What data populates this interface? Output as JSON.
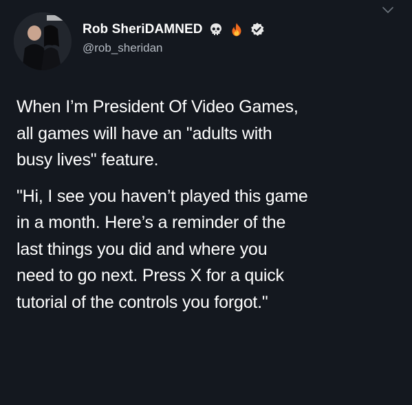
{
  "tweet": {
    "author": {
      "display_name": "Rob SheriDAMNED",
      "handle": "@rob_sheridan",
      "badges": [
        "skull-icon",
        "fire-icon",
        "verified-badge-icon"
      ]
    },
    "menu_icon": "chevron-down-icon",
    "paragraphs": [
      {
        "lines": [
          "When I’m President Of Video Games,",
          "all games will have an \"adults with",
          "busy lives\" feature."
        ]
      },
      {
        "lines": [
          "\"Hi, I see you haven’t played this game",
          "in a month. Here’s a reminder of the",
          "last things you did and where you",
          "need to go next. Press X for a quick",
          "tutorial of the controls you forgot.\""
        ]
      }
    ]
  }
}
